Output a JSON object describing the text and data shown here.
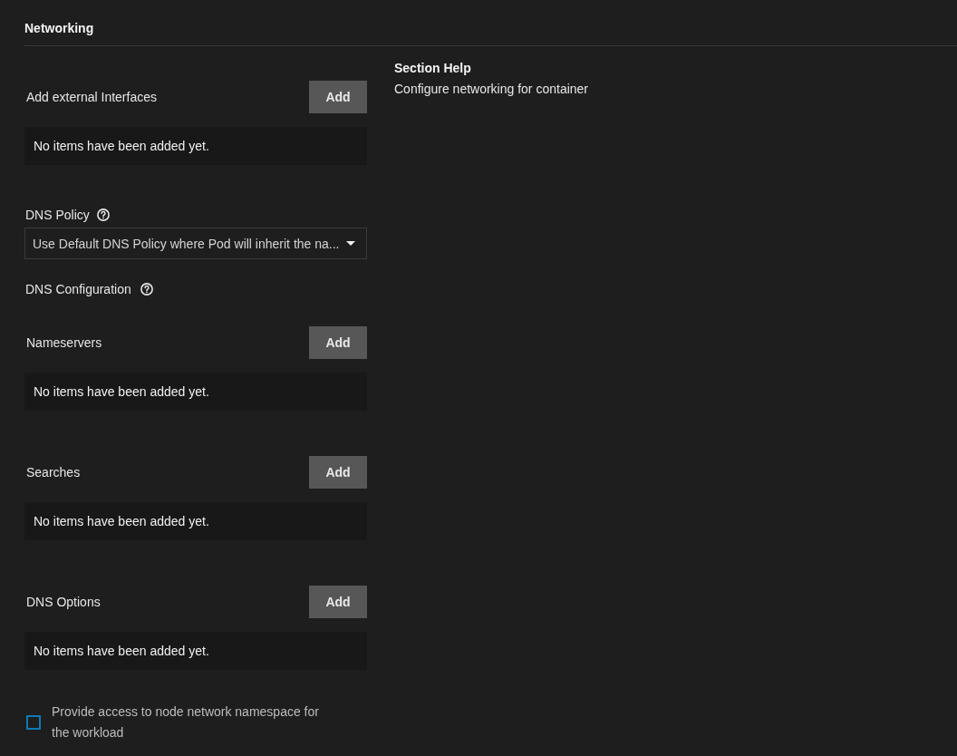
{
  "section": {
    "title": "Networking"
  },
  "fields": [
    {
      "kind": "list",
      "label": "Add external Interfaces",
      "button": "Add",
      "empty_text": "No items have been added yet."
    },
    {
      "kind": "select",
      "label": "DNS Policy",
      "help": true,
      "value": "Use Default DNS Policy where Pod will inherit the na..."
    },
    {
      "kind": "heading",
      "label": "DNS Configuration",
      "help": true
    },
    {
      "kind": "list",
      "label": "Nameservers",
      "button": "Add",
      "empty_text": "No items have been added yet."
    },
    {
      "kind": "list",
      "label": "Searches",
      "button": "Add",
      "empty_text": "No items have been added yet."
    },
    {
      "kind": "list",
      "label": "DNS Options",
      "button": "Add",
      "empty_text": "No items have been added yet."
    },
    {
      "kind": "checkbox",
      "label": "Provide access to node network namespace for the workload",
      "checked": false
    }
  ],
  "section_help": {
    "title": "Section Help",
    "text": "Configure networking for container"
  }
}
